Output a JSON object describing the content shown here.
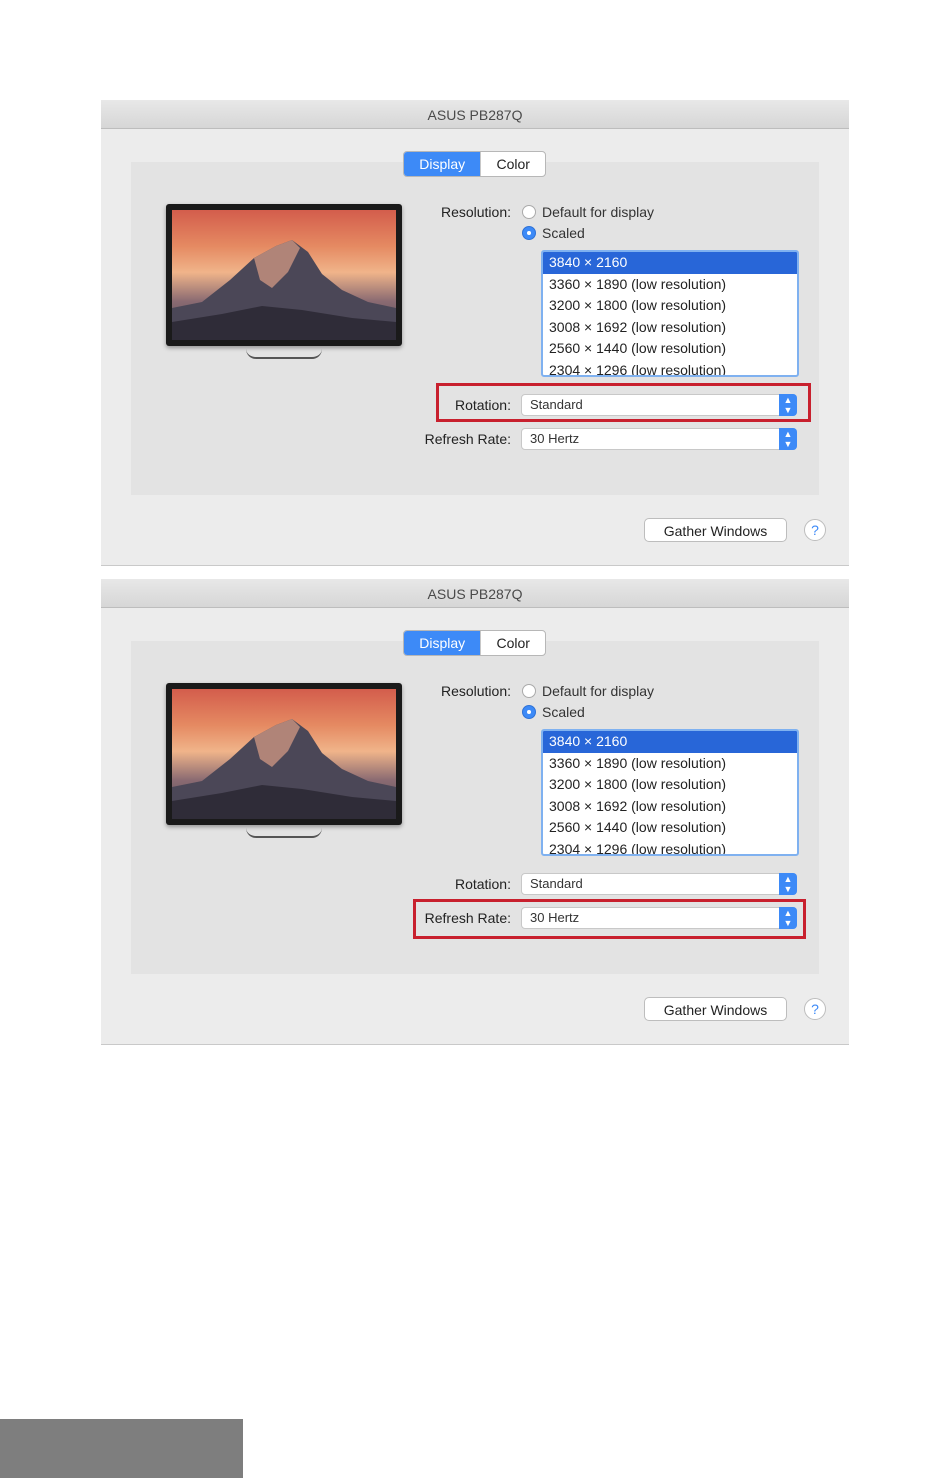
{
  "windows": [
    {
      "title": "ASUS PB287Q",
      "tabs": [
        {
          "label": "Display",
          "selected": true
        },
        {
          "label": "Color",
          "selected": false
        }
      ],
      "resolution_label": "Resolution:",
      "resolution_options": [
        {
          "label": "Default for display",
          "selected": false
        },
        {
          "label": "Scaled",
          "selected": true
        }
      ],
      "resolutions": [
        "3840 × 2160",
        "3360 × 1890 (low resolution)",
        "3200 × 1800 (low resolution)",
        "3008 × 1692 (low resolution)",
        "2560 × 1440 (low resolution)",
        "2304 × 1296 (low resolution)"
      ],
      "selected_resolution": "3840 × 2160",
      "rotation_label": "Rotation:",
      "rotation_value": "Standard",
      "refresh_label": "Refresh Rate:",
      "refresh_value": "30 Hertz",
      "highlighted": "rotation",
      "gather_label": "Gather Windows",
      "help_label": "?"
    },
    {
      "title": "ASUS PB287Q",
      "tabs": [
        {
          "label": "Display",
          "selected": true
        },
        {
          "label": "Color",
          "selected": false
        }
      ],
      "resolution_label": "Resolution:",
      "resolution_options": [
        {
          "label": "Default for display",
          "selected": false
        },
        {
          "label": "Scaled",
          "selected": true
        }
      ],
      "resolutions": [
        "3840 × 2160",
        "3360 × 1890 (low resolution)",
        "3200 × 1800 (low resolution)",
        "3008 × 1692 (low resolution)",
        "2560 × 1440 (low resolution)",
        "2304 × 1296 (low resolution)"
      ],
      "selected_resolution": "3840 × 2160",
      "rotation_label": "Rotation:",
      "rotation_value": "Standard",
      "refresh_label": "Refresh Rate:",
      "refresh_value": "30 Hertz",
      "highlighted": "refresh",
      "gather_label": "Gather Windows",
      "help_label": "?"
    }
  ],
  "colors": {
    "accent": "#3d8af7",
    "selection": "#2866d8",
    "highlight_box": "#c8202e",
    "window_bg": "#ececec",
    "panel_bg": "#e3e3e3"
  },
  "icons": {
    "monitor": "monitor-icon",
    "select_arrows": "updown-chevron-icon",
    "help": "help-icon"
  }
}
